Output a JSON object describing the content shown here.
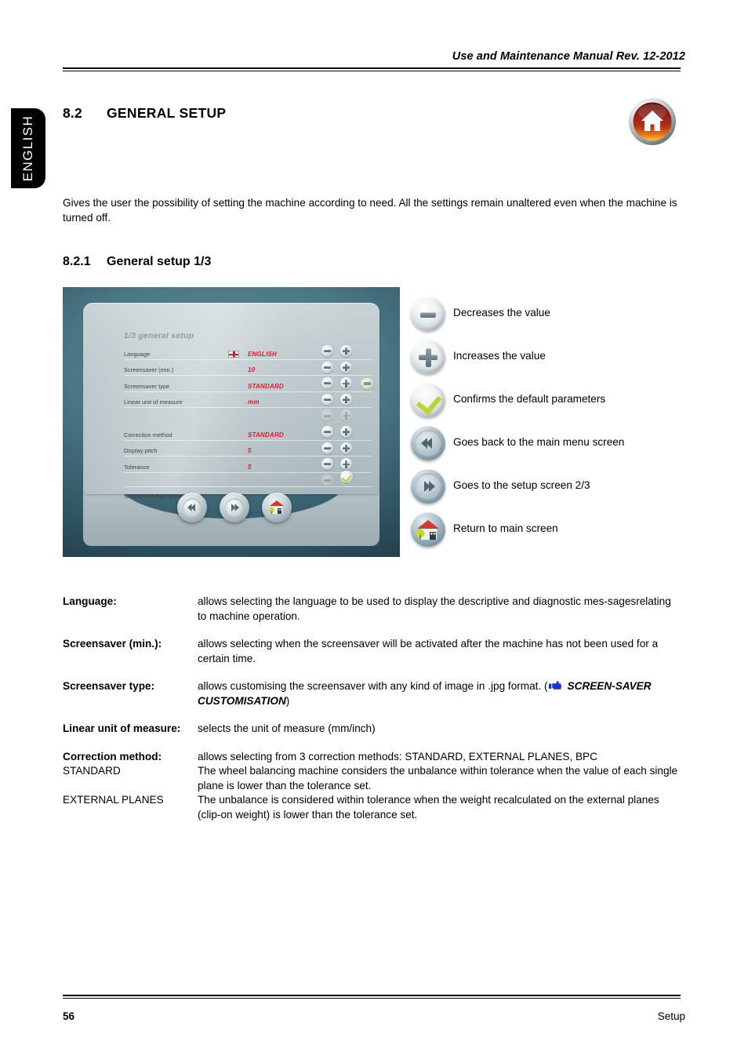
{
  "header": {
    "manual_title": "Use and Maintenance Manual Rev. 12-2012"
  },
  "side_tab": {
    "label": "ENGLISH"
  },
  "section": {
    "number": "8.2",
    "title": "GENERAL SETUP",
    "home_icon": "home-icon",
    "intro": "Gives the user the possibility of setting the machine according to need. All the settings remain unaltered even when the machine is turned off."
  },
  "subsection": {
    "number": "8.2.1",
    "title": "General setup 1/3"
  },
  "machine_screen": {
    "title": "1/3 general setup",
    "rows": [
      {
        "label": "Language",
        "value": "ENGLISH",
        "flag": "england-flag-icon",
        "controls": "pm",
        "dim": false
      },
      {
        "label": "Screensaver (min.)",
        "value": "10",
        "flag": null,
        "controls": "pm",
        "dim": false
      },
      {
        "label": "Screensaver type",
        "value": "STANDARD",
        "flag": null,
        "controls": "pm",
        "dim": false,
        "extra_button": true
      },
      {
        "label": "Linear unit of measure",
        "value": "mm",
        "flag": null,
        "controls": "pm",
        "dim": false
      },
      {
        "label": "",
        "value": "",
        "flag": null,
        "controls": "pm",
        "dim": true
      },
      {
        "label": "Correction method",
        "value": "STANDARD",
        "flag": null,
        "controls": "pm",
        "dim": false
      },
      {
        "label": "Display pitch",
        "value": "5",
        "flag": null,
        "controls": "pm",
        "dim": false
      },
      {
        "label": "Tolerance",
        "value": "5",
        "flag": null,
        "controls": "pm",
        "dim": false
      },
      {
        "label": "",
        "value": "",
        "flag": null,
        "controls": "pm",
        "dim": true
      }
    ],
    "default_row": {
      "label": "Setting of default parameters",
      "button": "check-button"
    },
    "nav_buttons": [
      {
        "icon": "back-arrow-icon",
        "glyph": "«←"
      },
      {
        "icon": "forward-arrow-icon",
        "glyph": "→»"
      },
      {
        "icon": "home-house-icon",
        "glyph": ""
      }
    ]
  },
  "legend": [
    {
      "icon": "minus-button-icon",
      "style": "silver",
      "text": "Decreases the value"
    },
    {
      "icon": "plus-button-icon",
      "style": "silver",
      "text": "Increases the value"
    },
    {
      "icon": "check-button-icon",
      "style": "silver",
      "text": "Confirms the default parameters"
    },
    {
      "icon": "back-arrow-button-icon",
      "style": "blue",
      "text": "Goes back to the main menu screen"
    },
    {
      "icon": "forward-arrow-button-icon",
      "style": "blue",
      "text": "Goes to the setup screen 2/3"
    },
    {
      "icon": "home-house-button-icon",
      "style": "blue",
      "text": "Return to main screen"
    }
  ],
  "definitions": {
    "language": {
      "term": "Language:",
      "body": "allows selecting the language to be used to display the descriptive and diagnostic mes-sagesrelating to machine operation."
    },
    "screensaver_min": {
      "term": "Screensaver (min.):",
      "body": "allows selecting when the screensaver will be activated after the machine has not been used for a certain time."
    },
    "screensaver_type": {
      "term": "Screensaver type:",
      "body_pre": "allows customising the screensaver with any kind of image in .jpg format. (",
      "hand_icon": "pointing-hand-icon",
      "body_emph": "SCREEN-SAVER CUSTOMISATION",
      "body_post": ")"
    },
    "linear_unit": {
      "term": "Linear unit of measure:",
      "body": "selects the unit of measure (mm/inch)"
    },
    "correction_method": {
      "term": "Correction method:",
      "body": "allows selecting from 3 correction methods: STANDARD, EXTERNAL PLANES, BPC",
      "standard_term": "STANDARD",
      "standard_body": "The wheel balancing machine considers the unbalance within tolerance when the value of each single plane is lower than the tolerance set.",
      "external_term": "EXTERNAL PLANES",
      "external_body": "The unbalance is considered within tolerance when the weight recalculated on the external planes (clip-on weight) is lower than the tolerance set."
    }
  },
  "footer": {
    "page_number": "56",
    "section_name": "Setup"
  }
}
